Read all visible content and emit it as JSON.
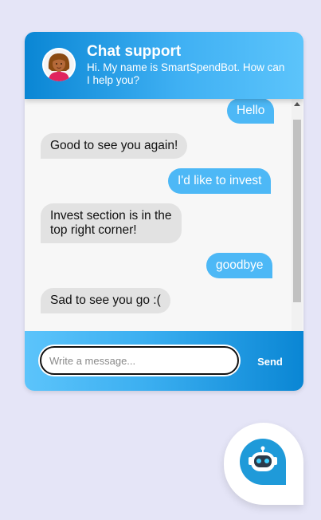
{
  "header": {
    "title": "Chat support",
    "subtitle": "Hi. My name is SmartSpendBot. How can I help you?",
    "gradient_colors": [
      "#0a86d4",
      "#5cc4fb"
    ]
  },
  "messages": [
    {
      "sender": "user",
      "text": "Hello"
    },
    {
      "sender": "bot",
      "text": "Good to see you again!"
    },
    {
      "sender": "user",
      "text": "I'd like to invest"
    },
    {
      "sender": "bot",
      "lines": [
        "Invest section is in the",
        "top right corner!"
      ]
    },
    {
      "sender": "user",
      "text": "goodbye"
    },
    {
      "sender": "bot",
      "text": "Sad to see you go :("
    }
  ],
  "input": {
    "placeholder": "Write a message...",
    "value": ""
  },
  "send_label": "Send",
  "colors": {
    "user_bubble": "#4db8f6",
    "bot_bubble": "#e2e2e2",
    "page_background": "#e5e5f7",
    "launcher_bubble": "#1f9ad9"
  },
  "icons": {
    "agent": "woman-avatar-icon",
    "launcher": "robot-chat-icon"
  }
}
